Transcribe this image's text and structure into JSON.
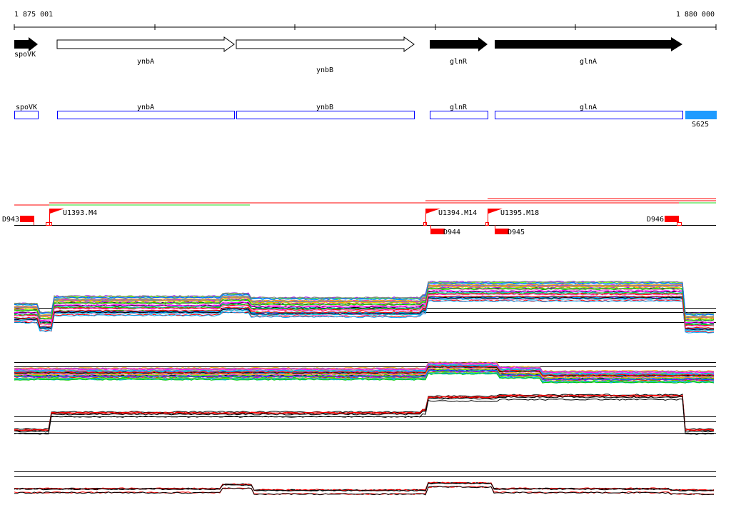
{
  "ruler": {
    "start_label": "1 875 001",
    "end_label": "1 880 000"
  },
  "genes": [
    {
      "name": "spoVK",
      "strand": "+",
      "filled": true
    },
    {
      "name": "ynbA",
      "strand": "+",
      "filled": false
    },
    {
      "name": "ynbB",
      "strand": "+",
      "filled": false
    },
    {
      "name": "glnR",
      "strand": "+",
      "filled": true
    },
    {
      "name": "glnA",
      "strand": "+",
      "filled": true
    }
  ],
  "annotations": [
    {
      "name": "spoVK"
    },
    {
      "name": "ynbA"
    },
    {
      "name": "ynbB"
    },
    {
      "name": "glnR"
    },
    {
      "name": "glnA"
    }
  ],
  "feature_s": {
    "name": "S625",
    "color": "#1e9bff"
  },
  "promoters": [
    {
      "label": "U1393.M4"
    },
    {
      "label": "U1394.M14"
    },
    {
      "label": "U1395.M18"
    }
  ],
  "terminators": [
    {
      "label": "D943"
    },
    {
      "label": "D944"
    },
    {
      "label": "D945"
    },
    {
      "label": "D946"
    }
  ],
  "colors": {
    "marker": "#ff0000",
    "gene_box": "#0000ff",
    "green": "#22dd22"
  }
}
